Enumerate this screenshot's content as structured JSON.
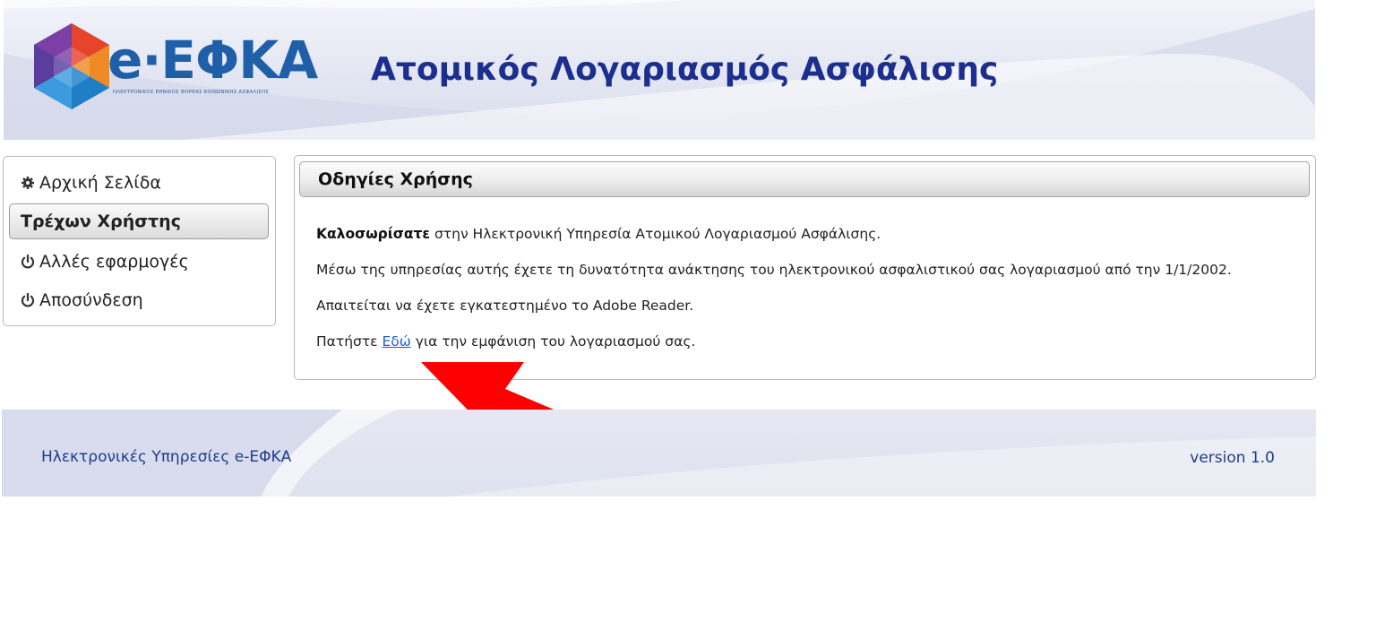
{
  "header": {
    "logo_text": "e·ΕΦΚΑ",
    "logo_tagline": "ΗΛΕΚΤΡΟΝΙΚΟΣ ΕΘΝΙΚΟΣ ΦΟΡΕΑΣ ΚΟΙΝΩΝΙΚΗΣ ΑΣΦΑΛΙΣΗΣ",
    "title": "Ατομικός Λογαριασμός Ασφάλισης"
  },
  "sidebar": {
    "items": [
      {
        "label": "Αρχική Σελίδα",
        "icon": "gear-icon"
      },
      {
        "label": "Τρέχων Χρήστης",
        "icon": ""
      },
      {
        "label": "Αλλές εφαρμογές",
        "icon": "power-icon"
      },
      {
        "label": "Αποσύνδεση",
        "icon": "power-icon"
      }
    ]
  },
  "main": {
    "heading": "Οδηγίες Χρήσης",
    "welcome_bold": "Καλοσωρίσατε",
    "welcome_rest": " στην Ηλεκτρονική Υπηρεσία Ατομικού Λογαριασμού Ασφάλισης.",
    "line2": "Μέσω της υπηρεσίας αυτής έχετε τη δυνατότητα ανάκτησης του ηλεκτρονικού ασφαλιστικού σας λογαριασμού από την 1/1/2002.",
    "line3": "Απαιτείται να έχετε εγκατεστημένο το Adobe Reader.",
    "line4_before": "Πατήστε ",
    "line4_link": "Εδώ",
    "line4_after": " για την εμφάνιση του λογαριασμού σας."
  },
  "footer": {
    "left": "Ηλεκτρονικές Υπηρεσίες e-ΕΦΚΑ",
    "right": "version 1.0"
  },
  "colors": {
    "brand_blue": "#1f5fa8",
    "title_navy": "#1c2f8f",
    "link_blue": "#1a5fd0",
    "arrow_red": "#ff0000"
  }
}
